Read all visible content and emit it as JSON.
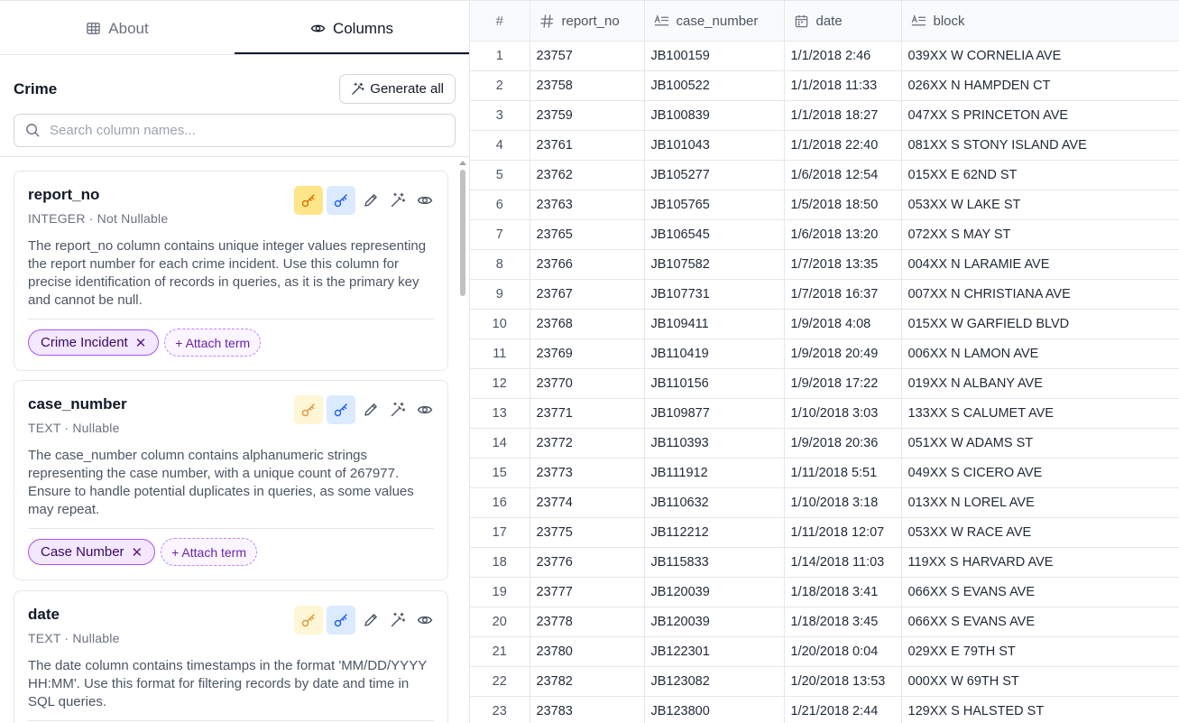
{
  "tabs": [
    {
      "label": "About",
      "icon": "table-icon",
      "active": false
    },
    {
      "label": "Columns",
      "icon": "eye-icon",
      "active": true
    }
  ],
  "model": {
    "title": "Crime"
  },
  "generate_all_label": "Generate all",
  "search": {
    "placeholder": "Search column names...",
    "value": ""
  },
  "attach_label": "+ Attach term",
  "columns": [
    {
      "name": "report_no",
      "type_line": "INTEGER · Not Nullable",
      "description": "The report_no column contains unique integer values representing the report number for each crime incident. Use this column for precise identification of records in queries, as it is the primary key and cannot be null.",
      "tags": [
        "Crime Incident"
      ],
      "primary_key": true
    },
    {
      "name": "case_number",
      "type_line": "TEXT · Nullable",
      "description": "The case_number column contains alphanumeric strings representing the case number, with a unique count of 267977. Ensure to handle potential duplicates in queries, as some values may repeat.",
      "tags": [
        "Case Number"
      ],
      "primary_key": false
    },
    {
      "name": "date",
      "type_line": "TEXT · Nullable",
      "description": "The date column contains timestamps in the format 'MM/DD/YYYY HH:MM'. Use this format for filtering records by date and time in SQL queries.",
      "tags": [],
      "primary_key": false
    }
  ],
  "table": {
    "index_header": "#",
    "headers": [
      {
        "label": "report_no",
        "icon": "hash-icon"
      },
      {
        "label": "case_number",
        "icon": "text-type-icon"
      },
      {
        "label": "date",
        "icon": "calendar-icon"
      },
      {
        "label": "block",
        "icon": "text-type-icon"
      }
    ],
    "rows": [
      [
        "1",
        "23757",
        "JB100159",
        "1/1/2018 2:46",
        "039XX W CORNELIA AVE"
      ],
      [
        "2",
        "23758",
        "JB100522",
        "1/1/2018 11:33",
        "026XX N HAMPDEN CT"
      ],
      [
        "3",
        "23759",
        "JB100839",
        "1/1/2018 18:27",
        "047XX S PRINCETON AVE"
      ],
      [
        "4",
        "23761",
        "JB101043",
        "1/1/2018 22:40",
        "081XX S STONY ISLAND AVE"
      ],
      [
        "5",
        "23762",
        "JB105277",
        "1/6/2018 12:54",
        "015XX E 62ND ST"
      ],
      [
        "6",
        "23763",
        "JB105765",
        "1/5/2018 18:50",
        "053XX W LAKE ST"
      ],
      [
        "7",
        "23765",
        "JB106545",
        "1/6/2018 13:20",
        "072XX S MAY ST"
      ],
      [
        "8",
        "23766",
        "JB107582",
        "1/7/2018 13:35",
        "004XX N LARAMIE AVE"
      ],
      [
        "9",
        "23767",
        "JB107731",
        "1/7/2018 16:37",
        "007XX N CHRISTIANA AVE"
      ],
      [
        "10",
        "23768",
        "JB109411",
        "1/9/2018 4:08",
        "015XX W GARFIELD BLVD"
      ],
      [
        "11",
        "23769",
        "JB110419",
        "1/9/2018 20:49",
        "006XX N LAMON AVE"
      ],
      [
        "12",
        "23770",
        "JB110156",
        "1/9/2018 17:22",
        "019XX N ALBANY AVE"
      ],
      [
        "13",
        "23771",
        "JB109877",
        "1/10/2018 3:03",
        "133XX S CALUMET AVE"
      ],
      [
        "14",
        "23772",
        "JB110393",
        "1/9/2018 20:36",
        "051XX W ADAMS ST"
      ],
      [
        "15",
        "23773",
        "JB111912",
        "1/11/2018 5:51",
        "049XX S CICERO AVE"
      ],
      [
        "16",
        "23774",
        "JB110632",
        "1/10/2018 3:18",
        "013XX N LOREL AVE"
      ],
      [
        "17",
        "23775",
        "JB112212",
        "1/11/2018 12:07",
        "053XX W RACE AVE"
      ],
      [
        "18",
        "23776",
        "JB115833",
        "1/14/2018 11:03",
        "119XX S HARVARD AVE"
      ],
      [
        "19",
        "23777",
        "JB120039",
        "1/18/2018 3:41",
        "066XX S EVANS AVE"
      ],
      [
        "20",
        "23778",
        "JB120039",
        "1/18/2018 3:45",
        "066XX S EVANS AVE"
      ],
      [
        "21",
        "23780",
        "JB122301",
        "1/20/2018 0:04",
        "029XX E 79TH ST"
      ],
      [
        "22",
        "23782",
        "JB123082",
        "1/20/2018 13:53",
        "000XX W 69TH ST"
      ],
      [
        "23",
        "23783",
        "JB123800",
        "1/21/2018 2:44",
        "129XX S HALSTED ST"
      ]
    ]
  }
}
